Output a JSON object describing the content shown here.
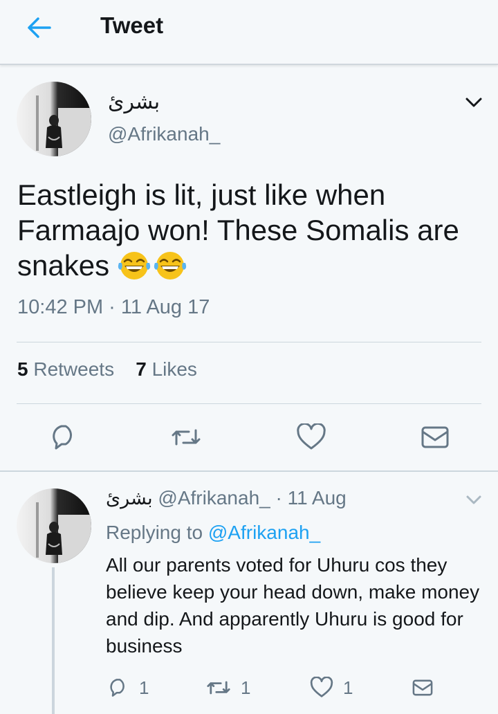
{
  "header": {
    "title": "Tweet",
    "back_icon": "arrow-left-icon",
    "accent": "#1da1f2"
  },
  "tweet": {
    "author_name": "بشرئ",
    "handle": "@Afrikanah_",
    "text": "Eastleigh is lit, just like when Farmaajo won! These Somalis are snakes",
    "emojis": [
      "tears-of-joy-emoji",
      "tears-of-joy-emoji"
    ],
    "timestamp": "10:42 PM · 11 Aug 17",
    "retweets_count": "5",
    "retweets_label": "Retweets",
    "likes_count": "7",
    "likes_label": "Likes",
    "actions": [
      "reply-icon",
      "retweet-icon",
      "like-icon",
      "direct-message-icon"
    ]
  },
  "reply": {
    "author_name": "بشرئ",
    "handle": "@Afrikanah_",
    "date": "· 11 Aug",
    "replying_prefix": "Replying to",
    "replying_to": "@Afrikanah_",
    "text": "All our parents voted for Uhuru cos they believe keep your head down, make money and dip. And apparently Uhuru is good for business",
    "reply_count": "1",
    "retweet_count": "1",
    "like_count": "1"
  }
}
